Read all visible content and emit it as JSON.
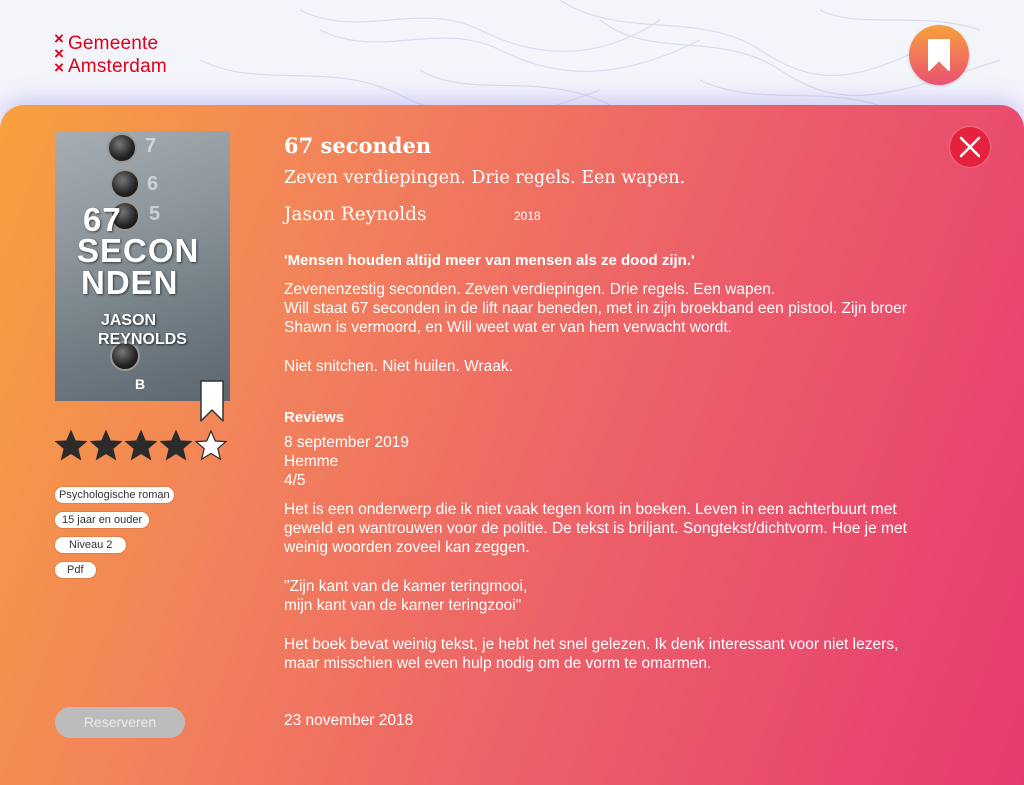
{
  "logo": {
    "marks": [
      "×",
      "×",
      "×"
    ],
    "line1": "Gemeente",
    "line2": "Amsterdam"
  },
  "favorite_top": {
    "icon": "bookmark-icon"
  },
  "book": {
    "cover": {
      "title_line1": "67",
      "title_line2": "SECO",
      "title_line2b": "N",
      "title_line3": "NDEN",
      "author_line1": "JASON",
      "author_line2": "REYNOLDS",
      "publisher_mark": "B"
    },
    "title": "67 seconden",
    "subtitle": "Zeven verdiepingen. Drie regels. Een wapen.",
    "author": "Jason Reynolds",
    "year": "2018",
    "rating": 4,
    "rating_max": 5,
    "quote": "'Mensen houden altijd meer van mensen als ze dood zijn.'",
    "description": [
      "Zevenenzestig seconden. Zeven verdiepingen. Drie regels. Een wapen.",
      "Will staat 67 seconden in de lift naar beneden, met in zijn broekband een pistool. Zijn broer Shawn is vermoord, en Will weet wat er van hem verwacht wordt.",
      "Niet snitchen. Niet huilen. Wraak."
    ]
  },
  "tags": [
    "Psychologische roman",
    "15 jaar en ouder",
    "Niveau 2",
    "Pdf"
  ],
  "reserve_label": "Reserveren",
  "reviews": {
    "heading": "Reviews",
    "items": [
      {
        "date": "8 september 2019",
        "name": "Hemme",
        "score": "4/5",
        "p1": "Het is een onderwerp die ik niet vaak tegen kom in boeken. Leven in een achterbuurt met geweld en wantrouwen voor de politie. De tekst is briljant. Songtekst/dichtvorm. Hoe je met weinig woorden zoveel kan zeggen.",
        "p2a": "\"Zijn kant van de kamer teringmooi,",
        "p2b": "mijn kant van de kamer teringzooi\"",
        "p3": "Het boek bevat weinig tekst, je hebt het snel gelezen. Ik denk interessant voor niet lezers, maar misschien wel even hulp nodig om de vorm te omarmen."
      },
      {
        "date": "23 november 2018"
      }
    ]
  },
  "colors": {
    "brand_red": "#e1001a",
    "panel_start": "#f8a03d",
    "panel_end": "#e63b6f",
    "close_button": "#e5223d",
    "star_fill": "#2b2b2b"
  }
}
